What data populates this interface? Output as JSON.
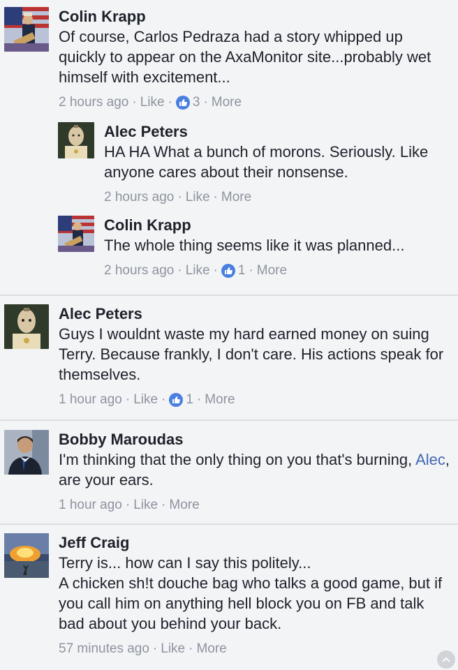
{
  "comments": [
    {
      "author": "Colin Krapp",
      "text": "Of course, Carlos Pedraza had a story whipped up quickly to appear on the AxaMonitor site...probably wet himself with excitement...",
      "time": "2 hours ago",
      "like_label": "Like",
      "reactions": "3",
      "more_label": "More",
      "replies": [
        {
          "author": "Alec Peters",
          "text": "HA HA What a bunch of morons. Seriously. Like anyone cares about their nonsense.",
          "time": "2 hours ago",
          "like_label": "Like",
          "more_label": "More"
        },
        {
          "author": "Colin Krapp",
          "text": "The whole thing seems like it was planned...",
          "time": "2 hours ago",
          "like_label": "Like",
          "reactions": "1",
          "more_label": "More"
        }
      ]
    },
    {
      "author": "Alec Peters",
      "text": "Guys I wouldnt waste my hard earned money on suing Terry. Because frankly, I don't care. His actions speak for themselves.",
      "time": "1 hour ago",
      "like_label": "Like",
      "reactions": "1",
      "more_label": "More"
    },
    {
      "author": "Bobby Maroudas",
      "text_before": "I'm thinking that the only thing on you that's burning,",
      "mention": "Alec",
      "text_after": ", are your ears.",
      "time": "1 hour ago",
      "like_label": "Like",
      "more_label": "More"
    },
    {
      "author": "Jeff Craig",
      "text_line1": "Terry is... how can I say this politely...",
      "text_line2": "A chicken sh!t douche bag who talks a good game, but if you call him on anything hell block you on FB and talk bad about you behind your back.",
      "time": "57 minutes ago",
      "like_label": "Like",
      "more_label": "More"
    }
  ],
  "sep": "·",
  "colors": {
    "link": "#4267b2",
    "meta": "#8d949e",
    "like_badge": "#4a7fe0"
  },
  "icons": {
    "like": "thumbs-up-icon",
    "scroll": "chevron-up-icon"
  }
}
